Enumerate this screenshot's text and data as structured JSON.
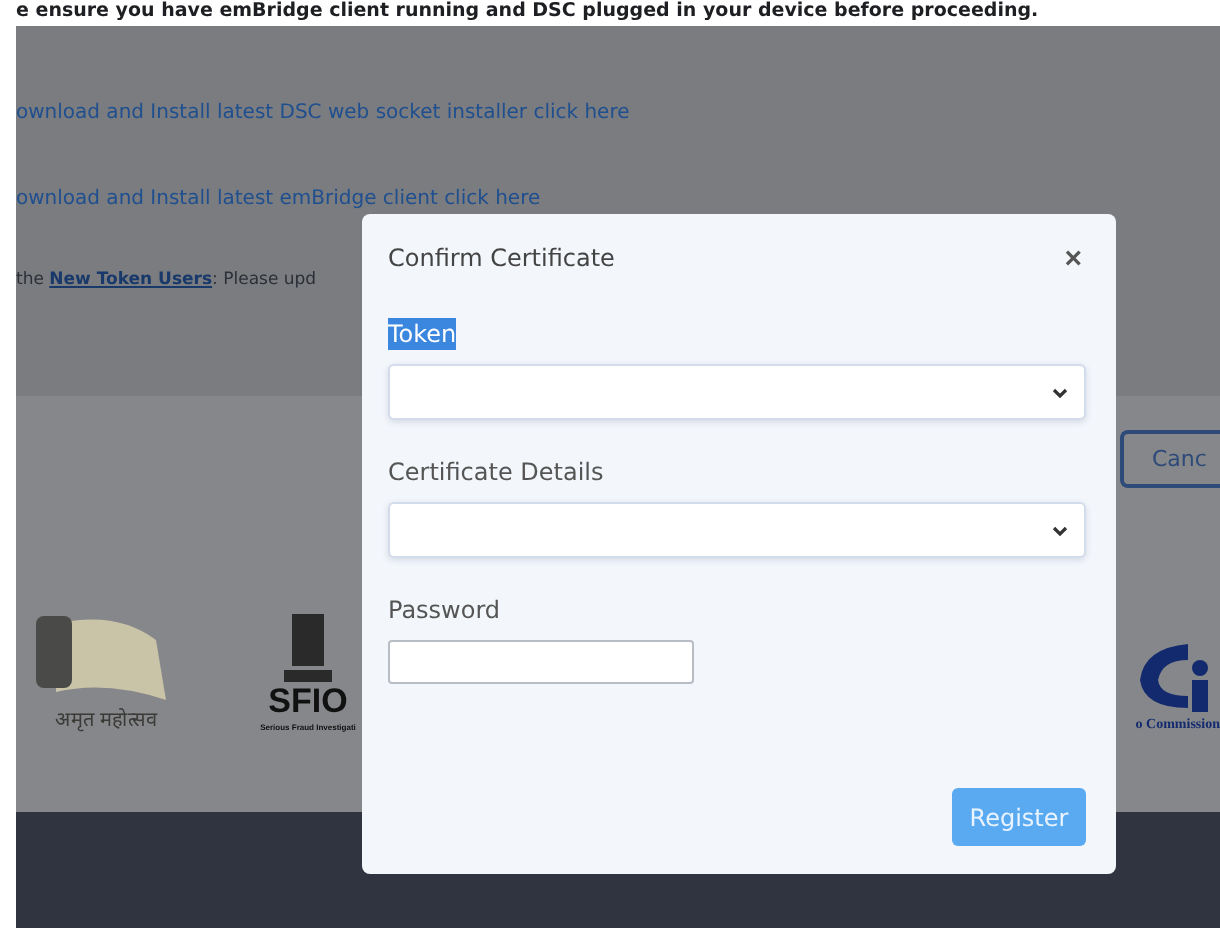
{
  "page": {
    "notice": "e ensure you have emBridge client running and DSC plugged in your device before proceeding.",
    "links": [
      "ownload and Install latest DSC web socket installer click here",
      "ownload and Install latest emBridge client click here"
    ],
    "token_note": {
      "prefix": "the ",
      "link": "New Token Users",
      "rest": ": Please upd"
    },
    "cancel_button": "Canc",
    "logos": [
      {
        "kind": "amrit",
        "caption": "अमृत महोत्सव"
      },
      {
        "kind": "sfio",
        "title": "SFIO",
        "caption": "Serious Fraud Investigati"
      },
      {
        "kind": "commission",
        "caption": "o Commission"
      }
    ]
  },
  "dialog": {
    "title": "Confirm Certificate",
    "close": "×",
    "fields": [
      {
        "kind": "select",
        "label": "Token",
        "highlighted": true
      },
      {
        "kind": "select",
        "label": "Certificate Details",
        "highlighted": false
      },
      {
        "kind": "password",
        "label": "Password",
        "highlighted": false
      }
    ],
    "button": "Register"
  }
}
